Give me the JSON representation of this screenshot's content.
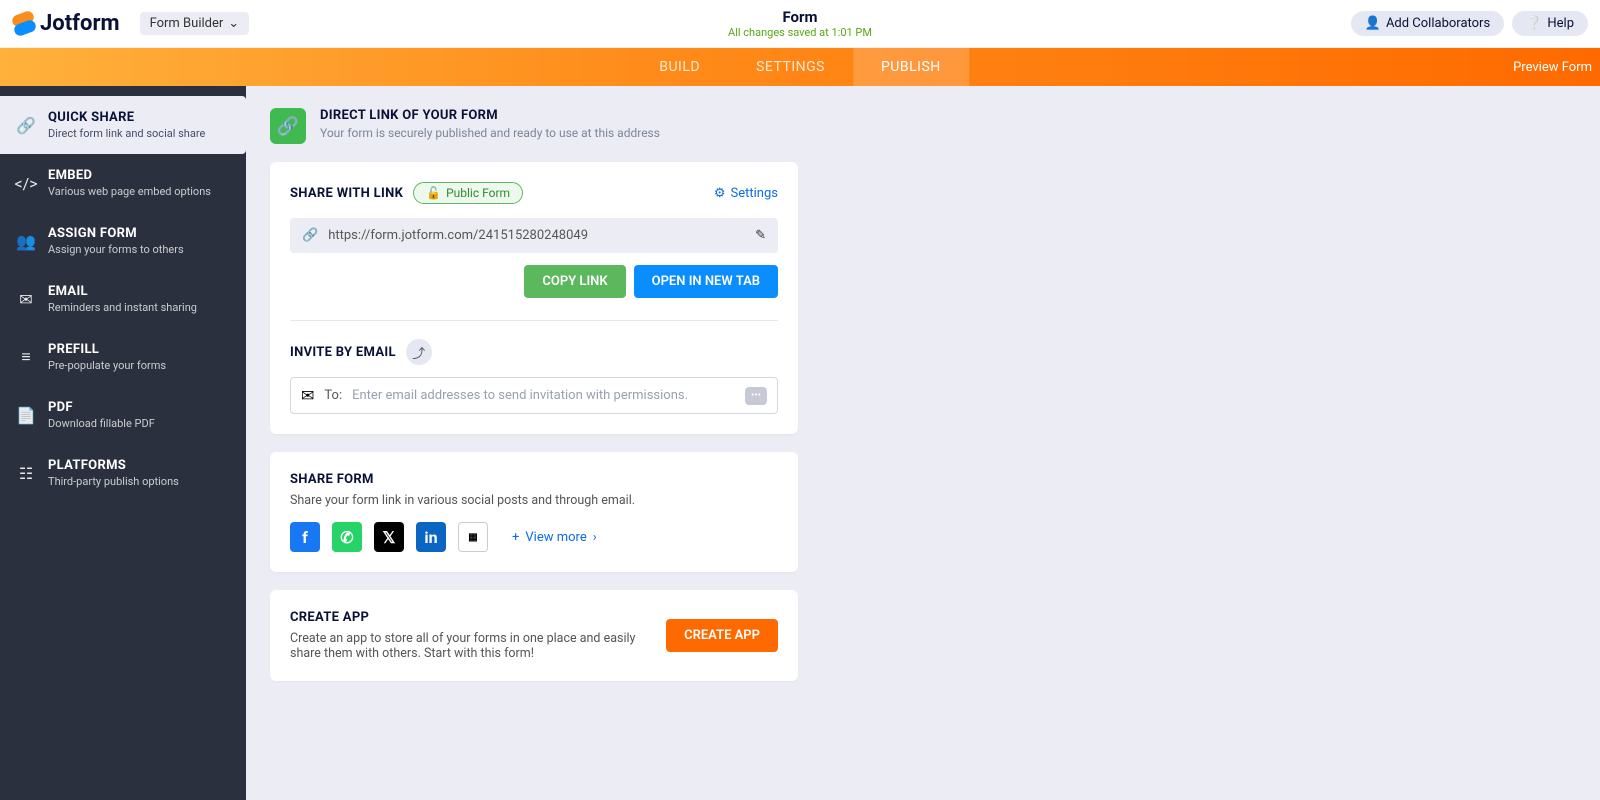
{
  "brand": "Jotform",
  "form_builder_label": "Form Builder",
  "header": {
    "title": "Form",
    "saved_status": "All changes saved at 1:01 PM",
    "add_collaborators": "Add Collaborators",
    "help": "Help"
  },
  "tabs": {
    "build": "BUILD",
    "settings": "SETTINGS",
    "publish": "PUBLISH",
    "preview": "Preview Form"
  },
  "sidebar": [
    {
      "title": "QUICK SHARE",
      "sub": "Direct form link and social share"
    },
    {
      "title": "EMBED",
      "sub": "Various web page embed options"
    },
    {
      "title": "ASSIGN FORM",
      "sub": "Assign your forms to others"
    },
    {
      "title": "EMAIL",
      "sub": "Reminders and instant sharing"
    },
    {
      "title": "PREFILL",
      "sub": "Pre-populate your forms"
    },
    {
      "title": "PDF",
      "sub": "Download fillable PDF"
    },
    {
      "title": "PLATFORMS",
      "sub": "Third-party publish options"
    }
  ],
  "direct": {
    "title": "DIRECT LINK OF YOUR FORM",
    "sub": "Your form is securely published and ready to use at this address"
  },
  "share_link": {
    "title": "SHARE WITH LINK",
    "badge": "Public Form",
    "settings": "Settings",
    "url": "https://form.jotform.com/241515280248049",
    "copy": "COPY LINK",
    "open": "OPEN IN NEW TAB"
  },
  "invite": {
    "title": "INVITE BY EMAIL",
    "to": "To:",
    "placeholder": "Enter email addresses to send invitation with permissions."
  },
  "share_form": {
    "title": "SHARE FORM",
    "sub": "Share your form link in various social posts and through email.",
    "view_more": "View more"
  },
  "create_app": {
    "title": "CREATE APP",
    "sub": "Create an app to store all of your forms in one place and easily share them with others. Start with this form!",
    "button": "CREATE APP"
  }
}
